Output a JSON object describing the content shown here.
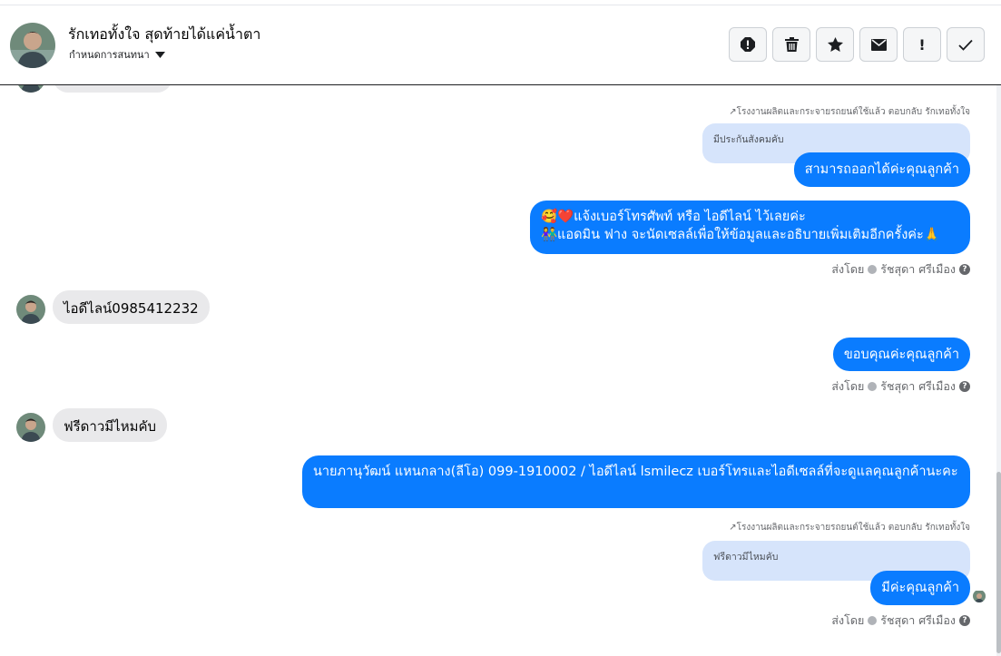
{
  "header": {
    "name": "รักเทอทั้งใจ สุดท้ายได้แค่น้ำตา",
    "subtitle": "กำหนดการสนทนา",
    "actions": [
      "spam-icon",
      "trash-icon",
      "star-icon",
      "envelope-icon",
      "exclamation-icon",
      "check-icon"
    ],
    "exclamation_label": "!"
  },
  "messages": {
    "reply1_hint": "โรงงานผลิตและกระจายรถยนต์ใช้แล้ว ตอบกลับ รักเทอทั้งใจ",
    "reply1_quote": "มีประกันสังคมคับ",
    "reply1_text": "สามารถออกได้ค่ะคุณลูกค้า",
    "out2_line1": "🥰❤️แจ้งเบอร์โทรศัพท์ หรือ ไอดีไลน์  ไว้เลยค่ะ",
    "out2_line2": "👫แอดมิน ฟาง จะนัดเซลล์เพื่อให้ข้อมูลและอธิบายเพิ่มเติมอีกครั้งค่ะ🙏",
    "sent_by_label": "ส่งโดย",
    "sent_by_name": "รัชสุดา ศรีเมือง",
    "in3_text": "ไอดีไลน์0985412232",
    "out4_text": "ขอบคุณค่ะคุณลูกค้า",
    "in5_text": "ฟรีดาวมีไหมคับ",
    "out6_text": "นายภานุวัฒน์ แหนกลาง(ลีโอ)       099-1910002 / ไอดีไลน์ lsmilecz   เบอร์โทรและไอดีเซลล์ที่จะดูแลคุณลูกค้านะคะ",
    "reply2_hint": "โรงงานผลิตและกระจายรถยนต์ใช้แล้ว ตอบกลับ รักเทอทั้งใจ",
    "reply2_quote": "ฟรีดาวมีไหมคับ",
    "reply2_text": "มีค่ะคุณลูกค้า"
  },
  "colors": {
    "outgoing": "#0a7cff",
    "incoming": "#e9e9eb",
    "quote": "#d6e4fb"
  }
}
